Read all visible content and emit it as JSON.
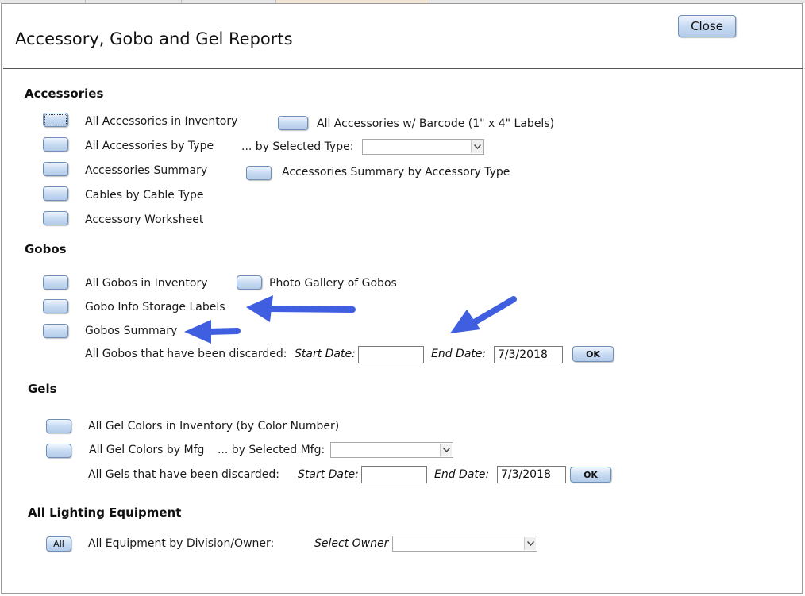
{
  "header": {
    "title": "Accessory, Gobo and Gel Reports",
    "close_label": "Close"
  },
  "accessories": {
    "heading": "Accessories",
    "all_in_inventory": "All Accessories in Inventory",
    "with_barcode": "All Accessories w/ Barcode (1\" x 4\" Labels)",
    "by_type": "All Accessories by Type",
    "by_selected_type": "... by Selected Type:",
    "summary": "Accessories  Summary",
    "summary_by_type": "Accessories  Summary by Accessory Type",
    "cables_by_type": "Cables by Cable Type",
    "worksheet": "Accessory Worksheet"
  },
  "gobos": {
    "heading": "Gobos",
    "all_in_inventory": "All Gobos in Inventory",
    "photo_gallery": "Photo Gallery of Gobos",
    "storage_labels": "Gobo Info Storage Labels",
    "summary": "Gobos Summary",
    "discarded": "All Gobos that have been discarded:",
    "start_date_label": "Start Date:",
    "start_date_value": "",
    "end_date_label": "End Date:",
    "end_date_value": "7/3/2018",
    "ok_label": "OK"
  },
  "gels": {
    "heading": "Gels",
    "all_in_inventory": "All Gel Colors in Inventory (by Color Number)",
    "by_mfg": "All Gel Colors by Mfg",
    "by_selected_mfg": "... by Selected Mfg:",
    "discarded": "All Gels that have been discarded:",
    "start_date_label": "Start Date:",
    "start_date_value": "",
    "end_date_label": "End Date:",
    "end_date_value": "7/3/2018",
    "ok_label": "OK"
  },
  "lighting": {
    "heading": "All Lighting Equipment",
    "all_label": "All",
    "by_division": "All Equipment by Division/Owner:",
    "select_owner": "Select Owner :"
  },
  "colors": {
    "arrow": "#3f5fe0",
    "button_border": "#6f8fb9"
  }
}
